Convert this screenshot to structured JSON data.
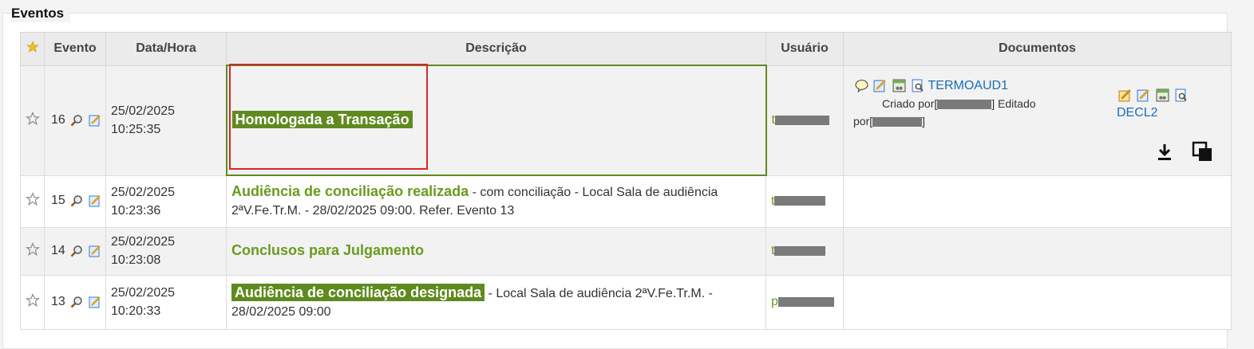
{
  "section_title": "Eventos",
  "columns": {
    "star": "",
    "evento": "Evento",
    "datahora": "Data/Hora",
    "descricao": "Descrição",
    "usuario": "Usuário",
    "documentos": "Documentos"
  },
  "rows": [
    {
      "num": "16",
      "date": "25/02/2025",
      "time": "10:25:35",
      "title": "Homologada a Transação",
      "rest": "",
      "user_prefix": "t",
      "doc1": {
        "name": "TERMOAUD1",
        "criado": "Criado por",
        "editado": "Editado",
        "por": "por"
      },
      "doc2": {
        "name": "DECL2"
      }
    },
    {
      "num": "15",
      "date": "25/02/2025",
      "time": "10:23:36",
      "title": "Audiência de conciliação realizada",
      "rest": " - com conciliação - Local Sala de audiência 2ªV.Fe.Tr.M. - 28/02/2025 09:00. Refer. Evento 13",
      "user_prefix": "t"
    },
    {
      "num": "14",
      "date": "25/02/2025",
      "time": "10:23:08",
      "title": "Conclusos para Julgamento",
      "rest": "",
      "user_prefix": "t"
    },
    {
      "num": "13",
      "date": "25/02/2025",
      "time": "10:20:33",
      "title": "Audiência de conciliação designada",
      "rest": " - Local Sala de audiência 2ªV.Fe.Tr.M. - 28/02/2025 09:00",
      "user_prefix": "p"
    }
  ],
  "colors": {
    "green": "#6a9a1f",
    "badge": "#5f8a1f",
    "link": "#1a6fb5",
    "highlight": "#d9262c"
  }
}
